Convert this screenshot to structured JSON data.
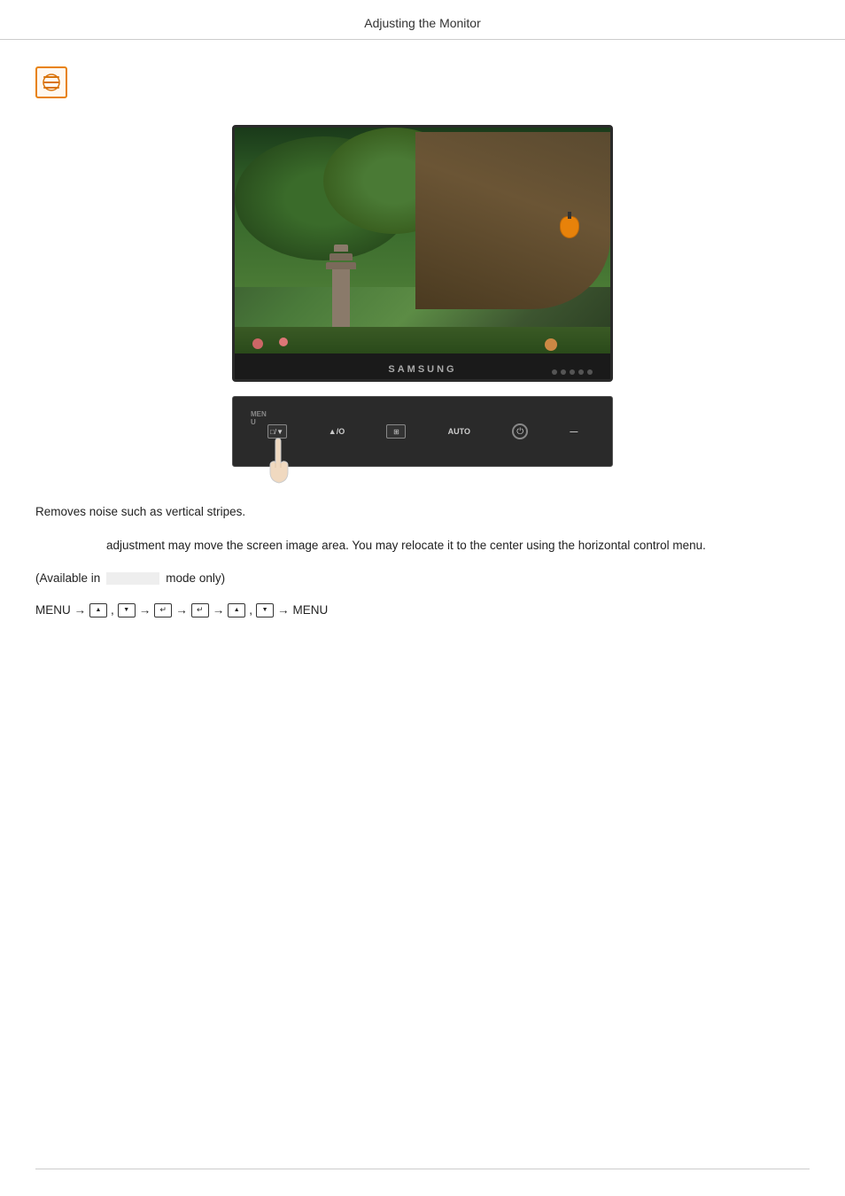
{
  "header": {
    "title": "Adjusting the Monitor",
    "top_border": true
  },
  "icon": {
    "type": "coarse-tune",
    "description": "Coarse tune adjustment icon with circular arrows"
  },
  "monitor": {
    "brand": "SAMSUNG",
    "screen_alt": "Garden scene with trees and pagoda"
  },
  "button_bar": {
    "items": [
      {
        "label": "MENU",
        "type": "text"
      },
      {
        "label": "□/▼",
        "type": "icon"
      },
      {
        "label": "▲/O",
        "type": "text"
      },
      {
        "label": "⊞",
        "type": "icon"
      },
      {
        "label": "AUTO",
        "type": "text"
      },
      {
        "label": "⏻",
        "type": "icon"
      },
      {
        "label": "—",
        "type": "text"
      }
    ]
  },
  "content": {
    "paragraph1": "Removes noise such as vertical stripes.",
    "paragraph2": "adjustment may move the screen image area. You may relocate it to the center using the horizontal control menu.",
    "available_line": {
      "prefix": "(Available in",
      "suffix": "mode only)"
    },
    "menu_nav": {
      "text": "MENU → ▲ , ▼ → ↵ → ↵ → ▲ , ▼ → MENU"
    }
  }
}
